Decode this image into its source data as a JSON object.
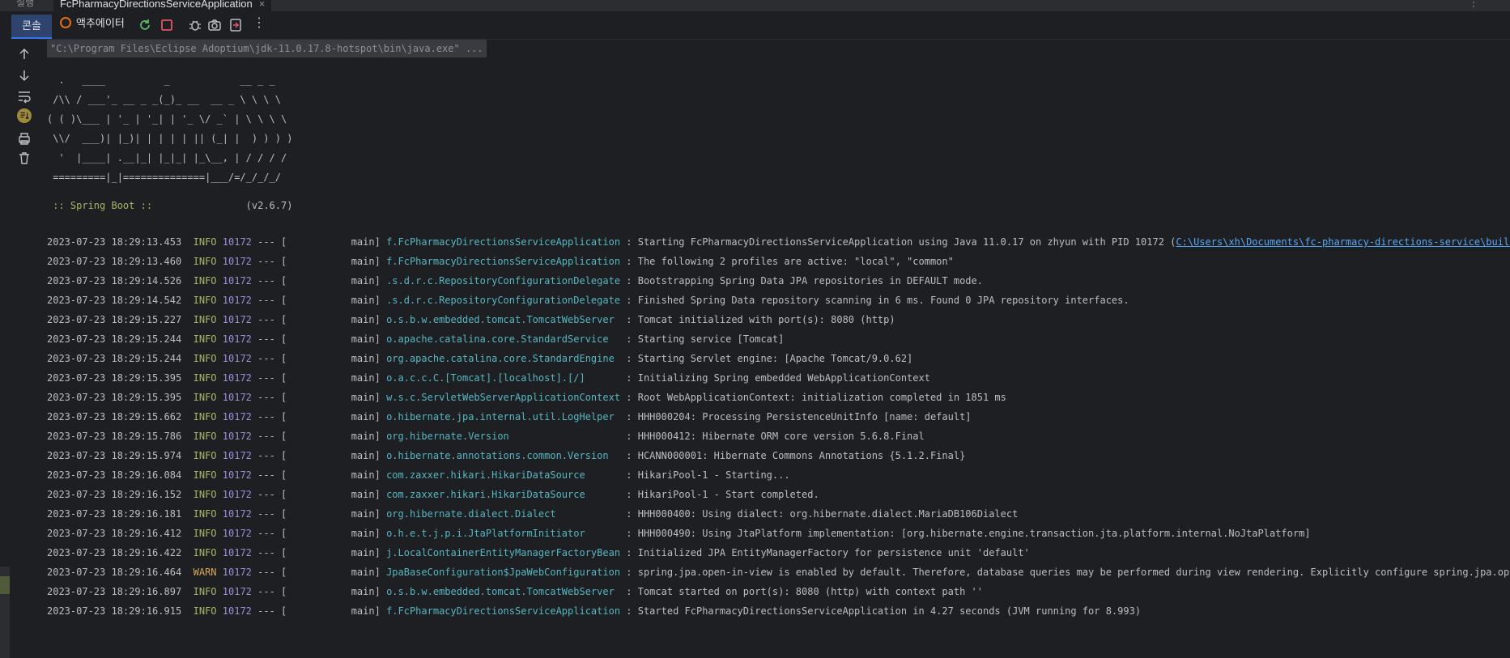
{
  "window": {
    "left_tab_label": "실행",
    "run_tab_label": "FcPharmacyDirectionsServiceApplication",
    "close_glyph": "×",
    "more_glyph": "⋮"
  },
  "toolbar": {
    "console_tab": "콘솔",
    "actuator_tab": "액추에이터",
    "more_glyph": "⋮"
  },
  "console": {
    "command_line": "\"C:\\Program Files\\Eclipse Adoptium\\jdk-11.0.17.8-hotspot\\bin\\java.exe\" ...",
    "banner": [
      "  .   ____          _            __ _ _",
      " /\\\\ / ___'_ __ _ _(_)_ __  __ _ \\ \\ \\ \\",
      "( ( )\\___ | '_ | '_| | '_ \\/ _` | \\ \\ \\ \\",
      " \\\\/  ___)| |_)| | | | | || (_| |  ) ) ) )",
      "  '  |____| .__|_| |_|_| |_\\__, | / / / /",
      " =========|_|==============|___/=/_/_/_/"
    ],
    "spring_boot_tag": " :: Spring Boot ::",
    "spring_boot_version": "                (v2.6.7)",
    "logs": [
      {
        "ts": "2023-07-23 18:29:13.453",
        "level": "INFO",
        "pid": "10172",
        "sep": " --- [           main] ",
        "logger": "f.FcPharmacyDirectionsServiceApplication",
        "msg": " : Starting FcPharmacyDirectionsServiceApplication using Java 11.0.17 on zhyun with PID 10172 (",
        "link": "C:\\Users\\xh\\Documents\\fc-pharmacy-directions-service\\build\\class"
      },
      {
        "ts": "2023-07-23 18:29:13.460",
        "level": "INFO",
        "pid": "10172",
        "sep": " --- [           main] ",
        "logger": "f.FcPharmacyDirectionsServiceApplication",
        "msg": " : The following 2 profiles are active: \"local\", \"common\"",
        "link": ""
      },
      {
        "ts": "2023-07-23 18:29:14.526",
        "level": "INFO",
        "pid": "10172",
        "sep": " --- [           main] ",
        "logger": ".s.d.r.c.RepositoryConfigurationDelegate",
        "msg": " : Bootstrapping Spring Data JPA repositories in DEFAULT mode.",
        "link": ""
      },
      {
        "ts": "2023-07-23 18:29:14.542",
        "level": "INFO",
        "pid": "10172",
        "sep": " --- [           main] ",
        "logger": ".s.d.r.c.RepositoryConfigurationDelegate",
        "msg": " : Finished Spring Data repository scanning in 6 ms. Found 0 JPA repository interfaces.",
        "link": ""
      },
      {
        "ts": "2023-07-23 18:29:15.227",
        "level": "INFO",
        "pid": "10172",
        "sep": " --- [           main] ",
        "logger": "o.s.b.w.embedded.tomcat.TomcatWebServer ",
        "msg": " : Tomcat initialized with port(s): 8080 (http)",
        "link": ""
      },
      {
        "ts": "2023-07-23 18:29:15.244",
        "level": "INFO",
        "pid": "10172",
        "sep": " --- [           main] ",
        "logger": "o.apache.catalina.core.StandardService  ",
        "msg": " : Starting service [Tomcat]",
        "link": ""
      },
      {
        "ts": "2023-07-23 18:29:15.244",
        "level": "INFO",
        "pid": "10172",
        "sep": " --- [           main] ",
        "logger": "org.apache.catalina.core.StandardEngine ",
        "msg": " : Starting Servlet engine: [Apache Tomcat/9.0.62]",
        "link": ""
      },
      {
        "ts": "2023-07-23 18:29:15.395",
        "level": "INFO",
        "pid": "10172",
        "sep": " --- [           main] ",
        "logger": "o.a.c.c.C.[Tomcat].[localhost].[/]      ",
        "msg": " : Initializing Spring embedded WebApplicationContext",
        "link": ""
      },
      {
        "ts": "2023-07-23 18:29:15.395",
        "level": "INFO",
        "pid": "10172",
        "sep": " --- [           main] ",
        "logger": "w.s.c.ServletWebServerApplicationContext",
        "msg": " : Root WebApplicationContext: initialization completed in 1851 ms",
        "link": ""
      },
      {
        "ts": "2023-07-23 18:29:15.662",
        "level": "INFO",
        "pid": "10172",
        "sep": " --- [           main] ",
        "logger": "o.hibernate.jpa.internal.util.LogHelper ",
        "msg": " : HHH000204: Processing PersistenceUnitInfo [name: default]",
        "link": ""
      },
      {
        "ts": "2023-07-23 18:29:15.786",
        "level": "INFO",
        "pid": "10172",
        "sep": " --- [           main] ",
        "logger": "org.hibernate.Version                   ",
        "msg": " : HHH000412: Hibernate ORM core version 5.6.8.Final",
        "link": ""
      },
      {
        "ts": "2023-07-23 18:29:15.974",
        "level": "INFO",
        "pid": "10172",
        "sep": " --- [           main] ",
        "logger": "o.hibernate.annotations.common.Version  ",
        "msg": " : HCANN000001: Hibernate Commons Annotations {5.1.2.Final}",
        "link": ""
      },
      {
        "ts": "2023-07-23 18:29:16.084",
        "level": "INFO",
        "pid": "10172",
        "sep": " --- [           main] ",
        "logger": "com.zaxxer.hikari.HikariDataSource      ",
        "msg": " : HikariPool-1 - Starting...",
        "link": ""
      },
      {
        "ts": "2023-07-23 18:29:16.152",
        "level": "INFO",
        "pid": "10172",
        "sep": " --- [           main] ",
        "logger": "com.zaxxer.hikari.HikariDataSource      ",
        "msg": " : HikariPool-1 - Start completed.",
        "link": ""
      },
      {
        "ts": "2023-07-23 18:29:16.181",
        "level": "INFO",
        "pid": "10172",
        "sep": " --- [           main] ",
        "logger": "org.hibernate.dialect.Dialect           ",
        "msg": " : HHH000400: Using dialect: org.hibernate.dialect.MariaDB106Dialect",
        "link": ""
      },
      {
        "ts": "2023-07-23 18:29:16.412",
        "level": "INFO",
        "pid": "10172",
        "sep": " --- [           main] ",
        "logger": "o.h.e.t.j.p.i.JtaPlatformInitiator      ",
        "msg": " : HHH000490: Using JtaPlatform implementation: [org.hibernate.engine.transaction.jta.platform.internal.NoJtaPlatform]",
        "link": ""
      },
      {
        "ts": "2023-07-23 18:29:16.422",
        "level": "INFO",
        "pid": "10172",
        "sep": " --- [           main] ",
        "logger": "j.LocalContainerEntityManagerFactoryBean",
        "msg": " : Initialized JPA EntityManagerFactory for persistence unit 'default'",
        "link": ""
      },
      {
        "ts": "2023-07-23 18:29:16.464",
        "level": "WARN",
        "pid": "10172",
        "sep": " --- [           main] ",
        "logger": "JpaBaseConfiguration$JpaWebConfiguration",
        "msg": " : spring.jpa.open-in-view is enabled by default. Therefore, database queries may be performed during view rendering. Explicitly configure spring.jpa.open-in-v",
        "link": ""
      },
      {
        "ts": "2023-07-23 18:29:16.897",
        "level": "INFO",
        "pid": "10172",
        "sep": " --- [           main] ",
        "logger": "o.s.b.w.embedded.tomcat.TomcatWebServer ",
        "msg": " : Tomcat started on port(s): 8080 (http) with context path ''",
        "link": ""
      },
      {
        "ts": "2023-07-23 18:29:16.915",
        "level": "INFO",
        "pid": "10172",
        "sep": " --- [           main] ",
        "logger": "f.FcPharmacyDirectionsServiceApplication",
        "msg": " : Started FcPharmacyDirectionsServiceApplication in 4.27 seconds (JVM running for 8.993)",
        "link": ""
      }
    ]
  },
  "colors": {
    "background": "#1e1f22",
    "text": "#bcbec4",
    "info": "#a9b665",
    "warn": "#d8a657",
    "pid": "#9e8dd8",
    "logger": "#56b6c2",
    "link": "#56a8f5",
    "accent": "#3574f0"
  }
}
